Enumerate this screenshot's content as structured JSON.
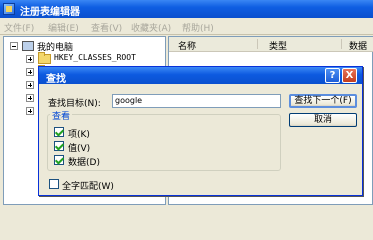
{
  "window": {
    "title": "注册表编辑器"
  },
  "menu": [
    {
      "label": "文件(F)"
    },
    {
      "label": "编辑(E)"
    },
    {
      "label": "查看(V)"
    },
    {
      "label": "收藏夹(A)"
    },
    {
      "label": "帮助(H)"
    }
  ],
  "tree": {
    "root_label": "我的电脑",
    "first_key": "HKEY_CLASSES_ROOT"
  },
  "list": {
    "columns": [
      {
        "label": "名称"
      },
      {
        "label": "类型"
      },
      {
        "label": "数据"
      }
    ]
  },
  "find_dialog": {
    "title": "查找",
    "help_glyph": "?",
    "close_glyph": "X",
    "find_what_label": "查找目标(N):",
    "find_what_value": "google",
    "find_next_label": "查找下一个(F)",
    "cancel_label": "取消",
    "look_at_label": "查看",
    "options": [
      {
        "label": "项(K)",
        "checked": true
      },
      {
        "label": "值(V)",
        "checked": true
      },
      {
        "label": "数据(D)",
        "checked": true
      }
    ],
    "match_whole": {
      "label": "全字匹配(W)",
      "checked": false
    }
  }
}
